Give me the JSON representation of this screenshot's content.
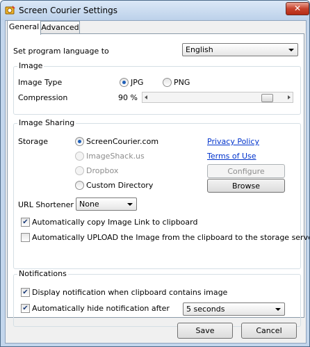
{
  "window": {
    "title": "Screen Courier Settings",
    "close_glyph": "✕",
    "app_icon": "screen-courier-logo"
  },
  "tabs": [
    {
      "label": "General",
      "active": true
    },
    {
      "label": "Advanced",
      "active": false
    }
  ],
  "language": {
    "label": "Set program language to",
    "value": "English"
  },
  "image": {
    "group_title": "Image",
    "type_label": "Image Type",
    "type_options": [
      {
        "label": "JPG",
        "selected": true
      },
      {
        "label": "PNG",
        "selected": false
      }
    ],
    "compression_label": "Compression",
    "compression_value": "90 %",
    "compression_level": 0.9
  },
  "sharing": {
    "group_title": "Image Sharing",
    "storage_label": "Storage",
    "storage_options": [
      {
        "label": "ScreenCourier.com",
        "selected": true,
        "enabled": true
      },
      {
        "label": "ImageShack.us",
        "selected": false,
        "enabled": false
      },
      {
        "label": "Dropbox",
        "selected": false,
        "enabled": false
      },
      {
        "label": "Custom Directory",
        "selected": false,
        "enabled": true
      }
    ],
    "privacy_link": "Privacy Policy",
    "terms_link": "Terms of Use",
    "configure_button": "Configure",
    "browse_button": "Browse",
    "url_shortener_label": "URL Shortener",
    "url_shortener_value": "None",
    "auto_copy_label": "Automatically copy Image Link to clipboard",
    "auto_copy_checked": true,
    "auto_upload_label": "Automatically UPLOAD the Image from the clipboard to the storage server",
    "auto_upload_checked": false
  },
  "notifications": {
    "group_title": "Notifications",
    "display_label": "Display notification when clipboard contains image",
    "display_checked": true,
    "hide_label": "Automatically hide notification after",
    "hide_checked": true,
    "hide_value": "5 seconds"
  },
  "footer": {
    "save_label": "Save",
    "cancel_label": "Cancel"
  },
  "colors": {
    "link": "#0033cc",
    "title_bar": "#c3d6ec",
    "close_button": "#c7432d"
  }
}
